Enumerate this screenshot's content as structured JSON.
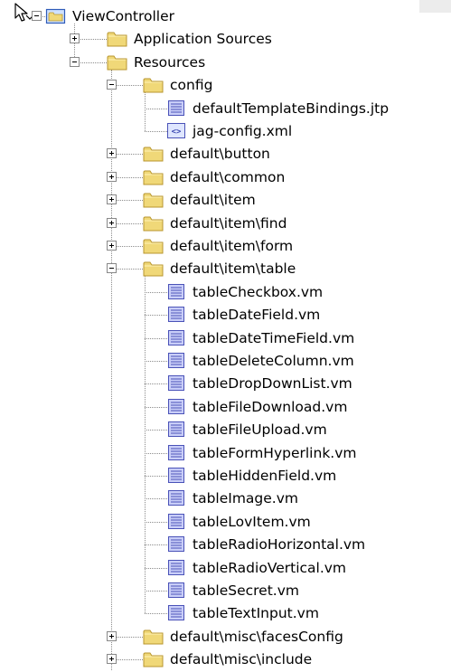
{
  "tree": [
    {
      "label": "ViewController",
      "level": 0,
      "icon": "project-folder-icon",
      "expander": "minus",
      "name": "tree-node-viewcontroller"
    },
    {
      "label": "Application Sources",
      "level": 1,
      "icon": "folder-icon",
      "expander": "plus",
      "name": "tree-node-application-sources"
    },
    {
      "label": "Resources",
      "level": 1,
      "icon": "folder-icon",
      "expander": "minus",
      "name": "tree-node-resources"
    },
    {
      "label": "config",
      "level": 2,
      "icon": "folder-icon",
      "expander": "minus",
      "name": "tree-node-config"
    },
    {
      "label": "defaultTemplateBindings.jtp",
      "level": 3,
      "icon": "file-icon",
      "expander": "none",
      "name": "tree-node-defaulttemplatebindings"
    },
    {
      "label": "jag-config.xml",
      "level": 3,
      "icon": "xml-file-icon",
      "expander": "none",
      "name": "tree-node-jag-config"
    },
    {
      "label": "default\\button",
      "level": 2,
      "icon": "folder-icon",
      "expander": "plus",
      "name": "tree-node-default-button"
    },
    {
      "label": "default\\common",
      "level": 2,
      "icon": "folder-icon",
      "expander": "plus",
      "name": "tree-node-default-common"
    },
    {
      "label": "default\\item",
      "level": 2,
      "icon": "folder-icon",
      "expander": "plus",
      "name": "tree-node-default-item"
    },
    {
      "label": "default\\item\\find",
      "level": 2,
      "icon": "folder-icon",
      "expander": "plus",
      "name": "tree-node-default-item-find"
    },
    {
      "label": "default\\item\\form",
      "level": 2,
      "icon": "folder-icon",
      "expander": "plus",
      "name": "tree-node-default-item-form"
    },
    {
      "label": "default\\item\\table",
      "level": 2,
      "icon": "folder-icon",
      "expander": "minus",
      "name": "tree-node-default-item-table"
    },
    {
      "label": "tableCheckbox.vm",
      "level": 3,
      "icon": "file-icon",
      "expander": "none",
      "name": "tree-node-tablecheckbox"
    },
    {
      "label": "tableDateField.vm",
      "level": 3,
      "icon": "file-icon",
      "expander": "none",
      "name": "tree-node-tabledatefield"
    },
    {
      "label": "tableDateTimeField.vm",
      "level": 3,
      "icon": "file-icon",
      "expander": "none",
      "name": "tree-node-tabledatetimefield"
    },
    {
      "label": "tableDeleteColumn.vm",
      "level": 3,
      "icon": "file-icon",
      "expander": "none",
      "name": "tree-node-tabledeletecolumn"
    },
    {
      "label": "tableDropDownList.vm",
      "level": 3,
      "icon": "file-icon",
      "expander": "none",
      "name": "tree-node-tabledropdownlist"
    },
    {
      "label": "tableFileDownload.vm",
      "level": 3,
      "icon": "file-icon",
      "expander": "none",
      "name": "tree-node-tablefiledownload"
    },
    {
      "label": "tableFileUpload.vm",
      "level": 3,
      "icon": "file-icon",
      "expander": "none",
      "name": "tree-node-tablefileupload"
    },
    {
      "label": "tableFormHyperlink.vm",
      "level": 3,
      "icon": "file-icon",
      "expander": "none",
      "name": "tree-node-tableformhyperlink"
    },
    {
      "label": "tableHiddenField.vm",
      "level": 3,
      "icon": "file-icon",
      "expander": "none",
      "name": "tree-node-tablehiddenfield"
    },
    {
      "label": "tableImage.vm",
      "level": 3,
      "icon": "file-icon",
      "expander": "none",
      "name": "tree-node-tableimage"
    },
    {
      "label": "tableLovItem.vm",
      "level": 3,
      "icon": "file-icon",
      "expander": "none",
      "name": "tree-node-tablelovitem"
    },
    {
      "label": "tableRadioHorizontal.vm",
      "level": 3,
      "icon": "file-icon",
      "expander": "none",
      "name": "tree-node-tableradiohorizontal"
    },
    {
      "label": "tableRadioVertical.vm",
      "level": 3,
      "icon": "file-icon",
      "expander": "none",
      "name": "tree-node-tableradiovertical"
    },
    {
      "label": "tableSecret.vm",
      "level": 3,
      "icon": "file-icon",
      "expander": "none",
      "name": "tree-node-tablesecret"
    },
    {
      "label": "tableTextInput.vm",
      "level": 3,
      "icon": "file-icon",
      "expander": "none",
      "name": "tree-node-tabletextinput"
    },
    {
      "label": "default\\misc\\facesConfig",
      "level": 2,
      "icon": "folder-icon",
      "expander": "plus",
      "name": "tree-node-default-misc-facesconfig"
    },
    {
      "label": "default\\misc\\include",
      "level": 2,
      "icon": "folder-icon",
      "expander": "plus",
      "name": "tree-node-default-misc-include"
    }
  ],
  "colors": {
    "folder": "#f0d878",
    "folder_edge": "#b8962e",
    "file": "#c9cef8",
    "file_edge": "#4a52b8",
    "connector": "#8c8c8c"
  }
}
